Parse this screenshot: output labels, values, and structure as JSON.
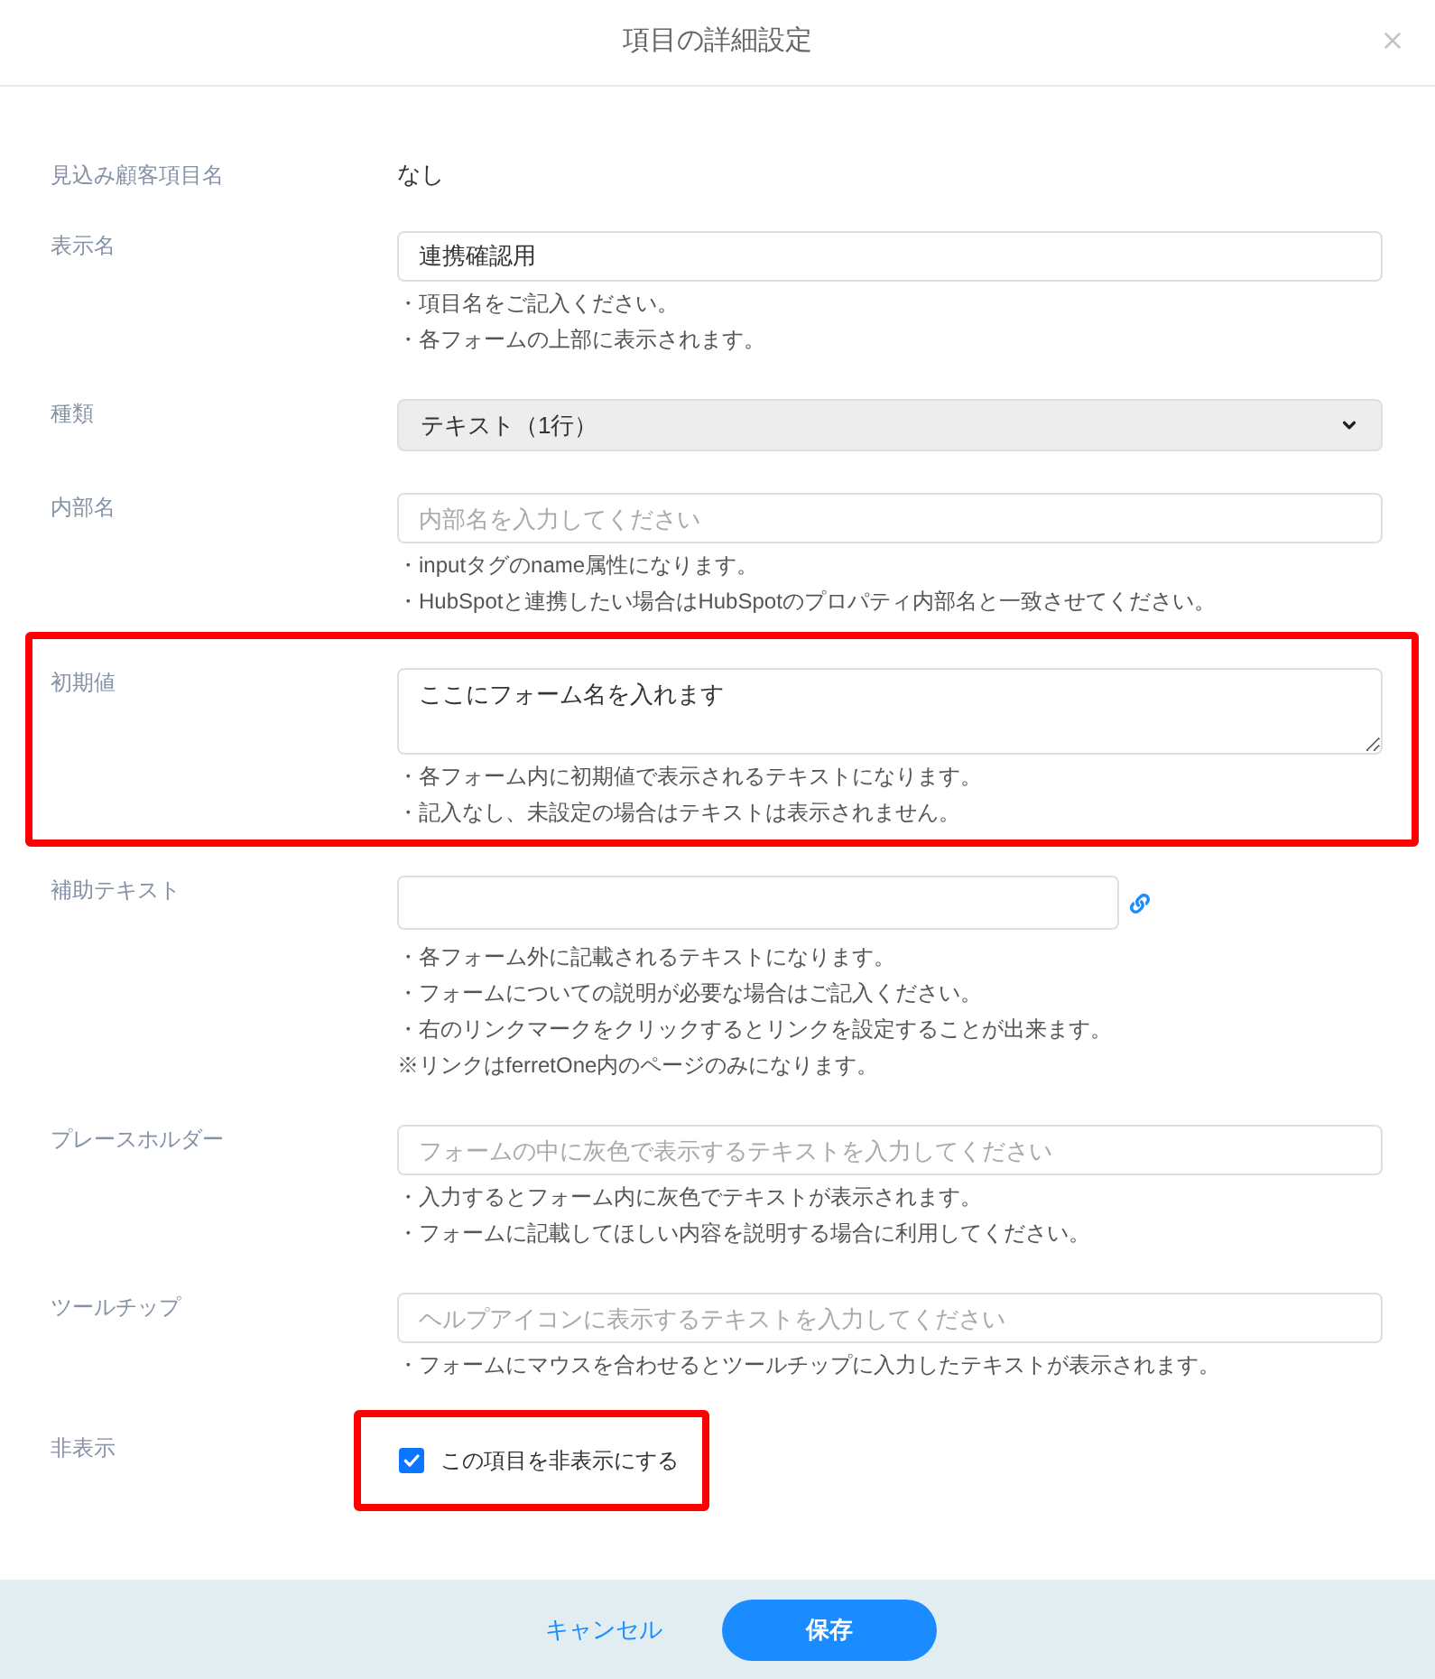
{
  "dialog": {
    "title": "項目の詳細設定"
  },
  "fields": [
    {
      "kind": "static",
      "label": "見込み顧客項目名",
      "value": "なし",
      "highlighted": false
    },
    {
      "kind": "input",
      "label": "表示名",
      "value": "連携確認用",
      "hints": [
        "・項目名をご記入ください。",
        "・各フォームの上部に表示されます。"
      ],
      "highlighted": false
    },
    {
      "kind": "select",
      "label": "種類",
      "value": "テキスト（1行）",
      "highlighted": false
    },
    {
      "kind": "input",
      "label": "内部名",
      "placeholder": "内部名を入力してください",
      "hints": [
        "・inputタグのname属性になります。",
        "・HubSpotと連携したい場合はHubSpotのプロパティ内部名と一致させてください。"
      ],
      "highlighted": false
    },
    {
      "kind": "textarea",
      "label": "初期値",
      "value": "ここにフォーム名を入れます",
      "hints": [
        "・各フォーム内に初期値で表示されるテキストになります。",
        "・記入なし、未設定の場合はテキストは表示されません。"
      ],
      "highlighted": true
    },
    {
      "kind": "input_link",
      "label": "補助テキスト",
      "hints": [
        "・各フォーム外に記載されるテキストになります。",
        "・フォームについての説明が必要な場合はご記入ください。",
        "・右のリンクマークをクリックするとリンクを設定することが出来ます。",
        "※リンクはferretOne内のページのみになります。"
      ],
      "highlighted": false
    },
    {
      "kind": "input",
      "label": "プレースホルダー",
      "placeholder": "フォームの中に灰色で表示するテキストを入力してください",
      "hints": [
        "・入力するとフォーム内に灰色でテキストが表示されます。",
        "・フォームに記載してほしい内容を説明する場合に利用してください。"
      ],
      "highlighted": false
    },
    {
      "kind": "input",
      "label": "ツールチップ",
      "placeholder": "ヘルプアイコンに表示するテキストを入力してください",
      "hints": [
        "・フォームにマウスを合わせるとツールチップに入力したテキストが表示されます。"
      ],
      "highlighted": false
    },
    {
      "kind": "checkbox",
      "label": "非表示",
      "text": "この項目を非表示にする",
      "checked": true,
      "highlighted": true
    }
  ],
  "footer": {
    "cancel_button": "キャンセル",
    "save_button": "保存"
  }
}
